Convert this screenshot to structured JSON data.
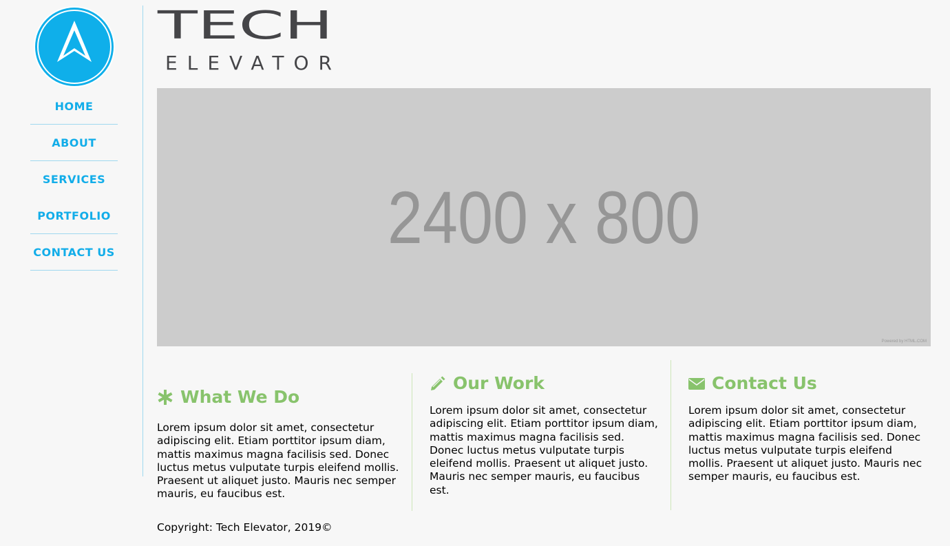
{
  "brand": {
    "line1": "TECH",
    "line2": "ELEVATOR"
  },
  "nav": {
    "items": [
      "HOME",
      "ABOUT",
      "SERVICES",
      "PORTFOLIO",
      "CONTACT US"
    ]
  },
  "hero": {
    "placeholder_text": "2400 x 800",
    "credit": "Powered by HTML.COM"
  },
  "sections": [
    {
      "title": "What We Do",
      "icon": "asterisk-icon",
      "body": "Lorem ipsum dolor sit amet, consectetur adipiscing elit. Etiam porttitor ipsum diam, mattis maximus magna facilisis sed. Donec luctus metus vulputate turpis eleifend mollis. Praesent ut aliquet justo. Mauris nec semper mauris, eu faucibus est."
    },
    {
      "title": "Our Work",
      "icon": "pencil-icon",
      "body": "Lorem ipsum dolor sit amet, consectetur adipiscing elit. Etiam porttitor ipsum diam, mattis maximus magna facilisis sed. Donec luctus metus vulputate turpis eleifend mollis. Praesent ut aliquet justo. Mauris nec semper mauris, eu faucibus est."
    },
    {
      "title": "Contact Us",
      "icon": "envelope-icon",
      "body": "Lorem ipsum dolor sit amet, consectetur adipiscing elit. Etiam porttitor ipsum diam, mattis maximus magna facilisis sed. Donec luctus metus vulputate turpis eleifend mollis. Praesent ut aliquet justo. Mauris nec semper mauris, eu faucibus est."
    }
  ],
  "footer": {
    "copyright": "Copyright: Tech Elevator, 2019©"
  },
  "colors": {
    "nav_accent": "#12ade9",
    "heading_green": "#88c36c",
    "page_background": "#f7f7f7",
    "hero_gray": "#cccccc"
  }
}
